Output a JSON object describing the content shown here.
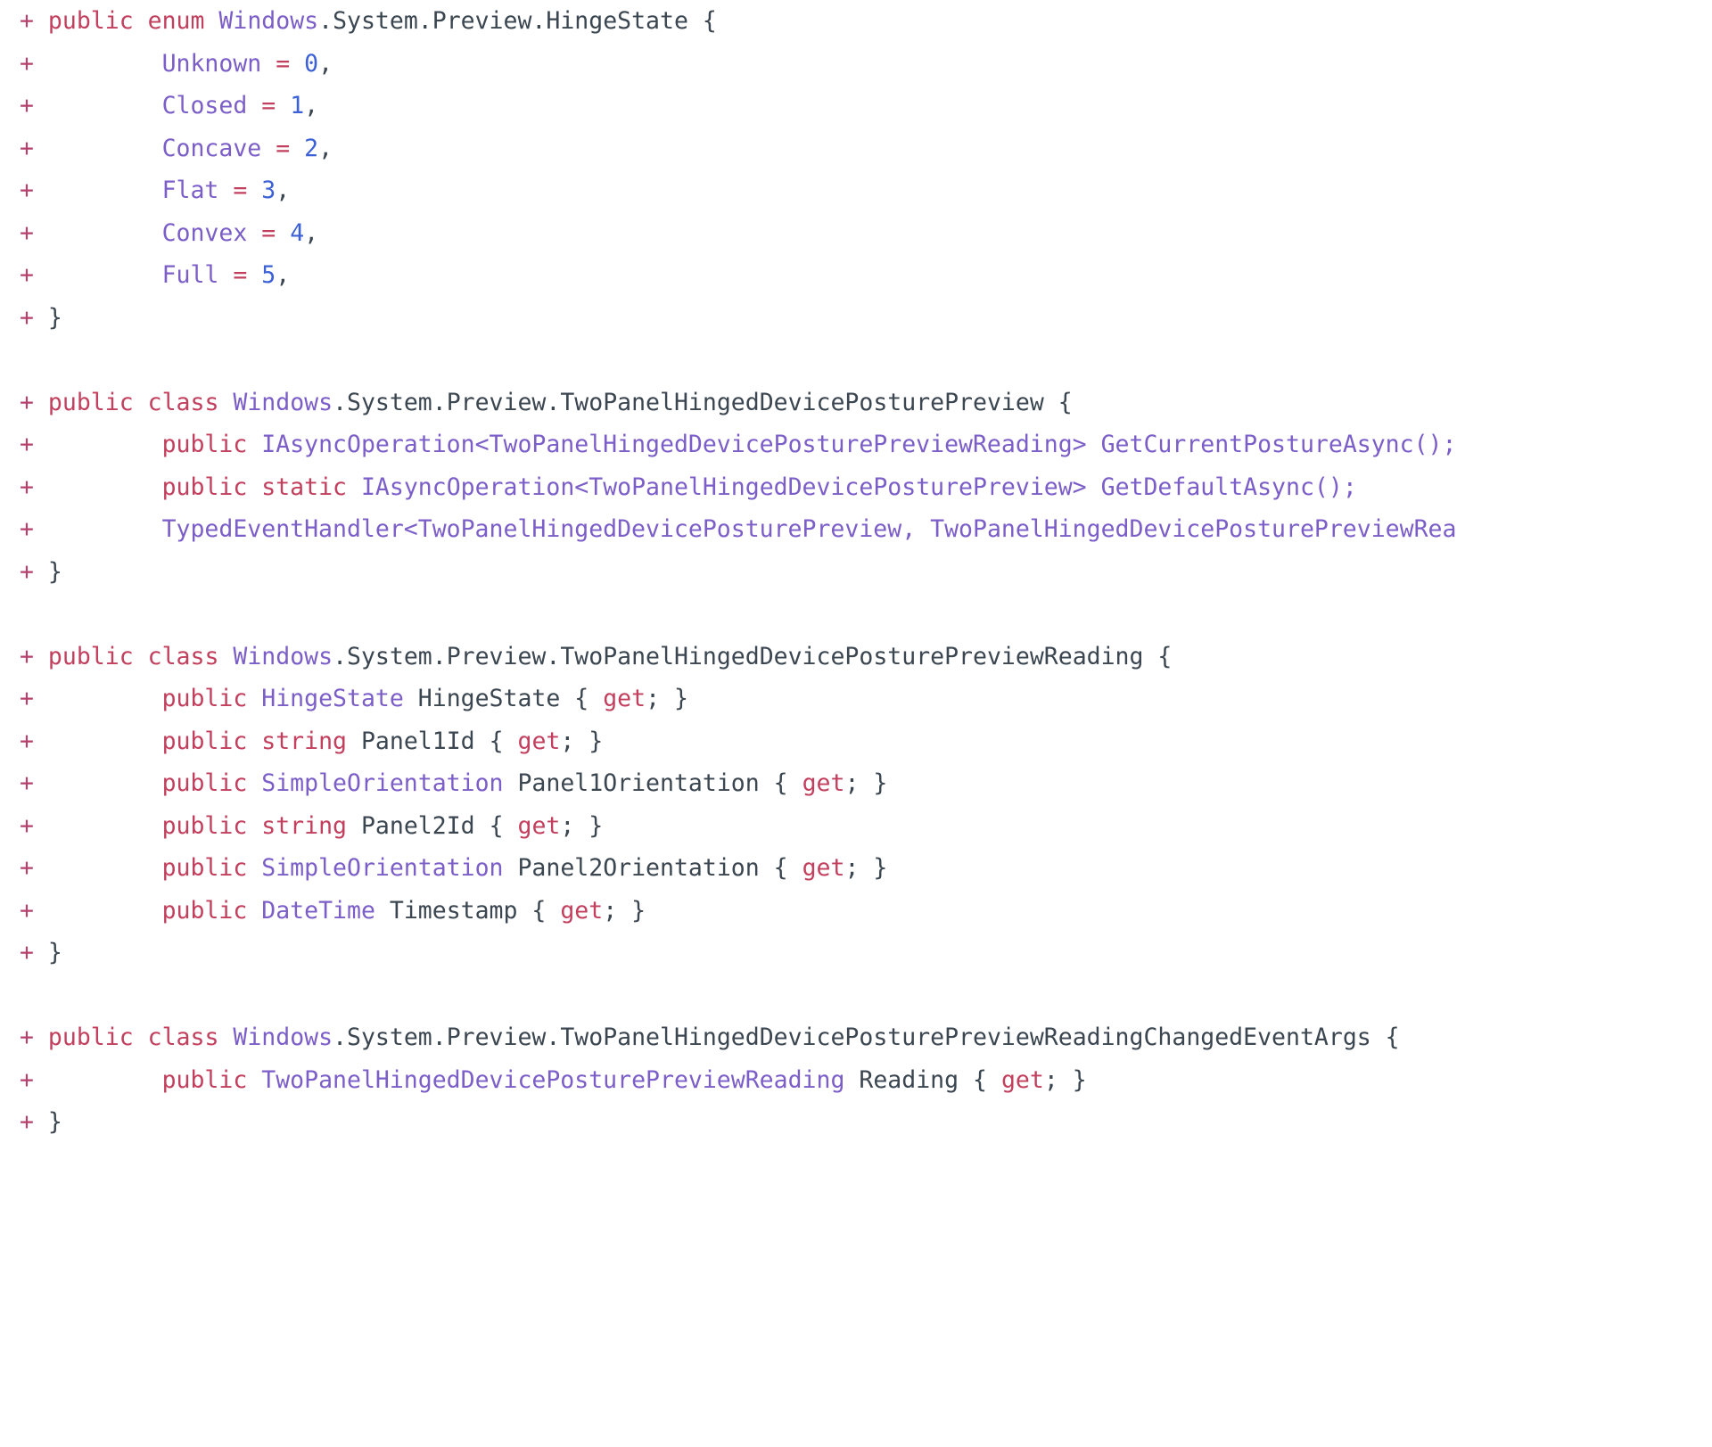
{
  "view": {
    "kind": "code-diff",
    "language": "csharp",
    "background": "#ffffff",
    "colors": {
      "diff_marker": "#b5416c",
      "keyword": "#c2405e",
      "type": "#7b5ec7",
      "identifier": "#3b4650",
      "number": "#3c61d6",
      "operator": "#c2405e",
      "punctuation": "#3b4650"
    }
  },
  "lines": [
    {
      "id": "l1",
      "marker": "+",
      "tokens": [
        {
          "t": "public",
          "c": "kw"
        },
        {
          "t": " ",
          "c": "plain"
        },
        {
          "t": "enum",
          "c": "kw"
        },
        {
          "t": " ",
          "c": "plain"
        },
        {
          "t": "Windows",
          "c": "type"
        },
        {
          "t": ".System.Preview.HingeState {",
          "c": "ident"
        }
      ]
    },
    {
      "id": "l2",
      "marker": "+",
      "indent": 8,
      "tokens": [
        {
          "t": "Unknown",
          "c": "type"
        },
        {
          "t": " ",
          "c": "plain"
        },
        {
          "t": "=",
          "c": "op"
        },
        {
          "t": " ",
          "c": "plain"
        },
        {
          "t": "0",
          "c": "num"
        },
        {
          "t": ",",
          "c": "punct"
        }
      ]
    },
    {
      "id": "l3",
      "marker": "+",
      "indent": 8,
      "tokens": [
        {
          "t": "Closed",
          "c": "type"
        },
        {
          "t": " ",
          "c": "plain"
        },
        {
          "t": "=",
          "c": "op"
        },
        {
          "t": " ",
          "c": "plain"
        },
        {
          "t": "1",
          "c": "num"
        },
        {
          "t": ",",
          "c": "punct"
        }
      ]
    },
    {
      "id": "l4",
      "marker": "+",
      "indent": 8,
      "tokens": [
        {
          "t": "Concave",
          "c": "type"
        },
        {
          "t": " ",
          "c": "plain"
        },
        {
          "t": "=",
          "c": "op"
        },
        {
          "t": " ",
          "c": "plain"
        },
        {
          "t": "2",
          "c": "num"
        },
        {
          "t": ",",
          "c": "punct"
        }
      ]
    },
    {
      "id": "l5",
      "marker": "+",
      "indent": 8,
      "tokens": [
        {
          "t": "Flat",
          "c": "type"
        },
        {
          "t": " ",
          "c": "plain"
        },
        {
          "t": "=",
          "c": "op"
        },
        {
          "t": " ",
          "c": "plain"
        },
        {
          "t": "3",
          "c": "num"
        },
        {
          "t": ",",
          "c": "punct"
        }
      ]
    },
    {
      "id": "l6",
      "marker": "+",
      "indent": 8,
      "tokens": [
        {
          "t": "Convex",
          "c": "type"
        },
        {
          "t": " ",
          "c": "plain"
        },
        {
          "t": "=",
          "c": "op"
        },
        {
          "t": " ",
          "c": "plain"
        },
        {
          "t": "4",
          "c": "num"
        },
        {
          "t": ",",
          "c": "punct"
        }
      ]
    },
    {
      "id": "l7",
      "marker": "+",
      "indent": 8,
      "tokens": [
        {
          "t": "Full",
          "c": "type"
        },
        {
          "t": " ",
          "c": "plain"
        },
        {
          "t": "=",
          "c": "op"
        },
        {
          "t": " ",
          "c": "plain"
        },
        {
          "t": "5",
          "c": "num"
        },
        {
          "t": ",",
          "c": "punct"
        }
      ]
    },
    {
      "id": "l8",
      "marker": "+",
      "tokens": [
        {
          "t": "}",
          "c": "punct"
        }
      ]
    },
    {
      "id": "l9",
      "blank": true
    },
    {
      "id": "l10",
      "marker": "+",
      "tokens": [
        {
          "t": "public",
          "c": "kw"
        },
        {
          "t": " ",
          "c": "plain"
        },
        {
          "t": "class",
          "c": "kw"
        },
        {
          "t": " ",
          "c": "plain"
        },
        {
          "t": "Windows",
          "c": "type"
        },
        {
          "t": ".System.Preview.TwoPanelHingedDevicePosturePreview {",
          "c": "ident"
        }
      ]
    },
    {
      "id": "l11",
      "marker": "+",
      "indent": 8,
      "tokens": [
        {
          "t": "public",
          "c": "kw"
        },
        {
          "t": " ",
          "c": "plain"
        },
        {
          "t": "IAsyncOperation<TwoPanelHingedDevicePosturePreviewReading>",
          "c": "type"
        },
        {
          "t": " ",
          "c": "plain"
        },
        {
          "t": "GetCurrentPostureAsync();",
          "c": "type"
        }
      ]
    },
    {
      "id": "l12",
      "marker": "+",
      "indent": 8,
      "tokens": [
        {
          "t": "public",
          "c": "kw"
        },
        {
          "t": " ",
          "c": "plain"
        },
        {
          "t": "static",
          "c": "kw"
        },
        {
          "t": " ",
          "c": "plain"
        },
        {
          "t": "IAsyncOperation<TwoPanelHingedDevicePosturePreview>",
          "c": "type"
        },
        {
          "t": " ",
          "c": "plain"
        },
        {
          "t": "GetDefaultAsync();",
          "c": "type"
        }
      ]
    },
    {
      "id": "l13",
      "marker": "+",
      "indent": 8,
      "tokens": [
        {
          "t": "TypedEventHandler<TwoPanelHingedDevicePosturePreview,",
          "c": "type"
        },
        {
          "t": " ",
          "c": "plain"
        },
        {
          "t": "TwoPanelHingedDevicePosturePreviewRea",
          "c": "type"
        }
      ]
    },
    {
      "id": "l14",
      "marker": "+",
      "tokens": [
        {
          "t": "}",
          "c": "punct"
        }
      ]
    },
    {
      "id": "l15",
      "blank": true
    },
    {
      "id": "l16",
      "marker": "+",
      "tokens": [
        {
          "t": "public",
          "c": "kw"
        },
        {
          "t": " ",
          "c": "plain"
        },
        {
          "t": "class",
          "c": "kw"
        },
        {
          "t": " ",
          "c": "plain"
        },
        {
          "t": "Windows",
          "c": "type"
        },
        {
          "t": ".System.Preview.TwoPanelHingedDevicePosturePreviewReading {",
          "c": "ident"
        }
      ]
    },
    {
      "id": "l17",
      "marker": "+",
      "indent": 8,
      "tokens": [
        {
          "t": "public",
          "c": "kw"
        },
        {
          "t": " ",
          "c": "plain"
        },
        {
          "t": "HingeState",
          "c": "type"
        },
        {
          "t": " ",
          "c": "plain"
        },
        {
          "t": "HingeState",
          "c": "ident"
        },
        {
          "t": " { ",
          "c": "punct"
        },
        {
          "t": "get",
          "c": "kw"
        },
        {
          "t": "; }",
          "c": "punct"
        }
      ]
    },
    {
      "id": "l18",
      "marker": "+",
      "indent": 8,
      "tokens": [
        {
          "t": "public",
          "c": "kw"
        },
        {
          "t": " ",
          "c": "plain"
        },
        {
          "t": "string",
          "c": "kw"
        },
        {
          "t": " ",
          "c": "plain"
        },
        {
          "t": "Panel1Id",
          "c": "ident"
        },
        {
          "t": " { ",
          "c": "punct"
        },
        {
          "t": "get",
          "c": "kw"
        },
        {
          "t": "; }",
          "c": "punct"
        }
      ]
    },
    {
      "id": "l19",
      "marker": "+",
      "indent": 8,
      "tokens": [
        {
          "t": "public",
          "c": "kw"
        },
        {
          "t": " ",
          "c": "plain"
        },
        {
          "t": "SimpleOrientation",
          "c": "type"
        },
        {
          "t": " ",
          "c": "plain"
        },
        {
          "t": "Panel1Orientation",
          "c": "ident"
        },
        {
          "t": " { ",
          "c": "punct"
        },
        {
          "t": "get",
          "c": "kw"
        },
        {
          "t": "; }",
          "c": "punct"
        }
      ]
    },
    {
      "id": "l20",
      "marker": "+",
      "indent": 8,
      "tokens": [
        {
          "t": "public",
          "c": "kw"
        },
        {
          "t": " ",
          "c": "plain"
        },
        {
          "t": "string",
          "c": "kw"
        },
        {
          "t": " ",
          "c": "plain"
        },
        {
          "t": "Panel2Id",
          "c": "ident"
        },
        {
          "t": " { ",
          "c": "punct"
        },
        {
          "t": "get",
          "c": "kw"
        },
        {
          "t": "; }",
          "c": "punct"
        }
      ]
    },
    {
      "id": "l21",
      "marker": "+",
      "indent": 8,
      "tokens": [
        {
          "t": "public",
          "c": "kw"
        },
        {
          "t": " ",
          "c": "plain"
        },
        {
          "t": "SimpleOrientation",
          "c": "type"
        },
        {
          "t": " ",
          "c": "plain"
        },
        {
          "t": "Panel2Orientation",
          "c": "ident"
        },
        {
          "t": " { ",
          "c": "punct"
        },
        {
          "t": "get",
          "c": "kw"
        },
        {
          "t": "; }",
          "c": "punct"
        }
      ]
    },
    {
      "id": "l22",
      "marker": "+",
      "indent": 8,
      "tokens": [
        {
          "t": "public",
          "c": "kw"
        },
        {
          "t": " ",
          "c": "plain"
        },
        {
          "t": "DateTime",
          "c": "type"
        },
        {
          "t": " ",
          "c": "plain"
        },
        {
          "t": "Timestamp",
          "c": "ident"
        },
        {
          "t": " { ",
          "c": "punct"
        },
        {
          "t": "get",
          "c": "kw"
        },
        {
          "t": "; }",
          "c": "punct"
        }
      ]
    },
    {
      "id": "l23",
      "marker": "+",
      "tokens": [
        {
          "t": "}",
          "c": "punct"
        }
      ]
    },
    {
      "id": "l24",
      "blank": true
    },
    {
      "id": "l25",
      "marker": "+",
      "tokens": [
        {
          "t": "public",
          "c": "kw"
        },
        {
          "t": " ",
          "c": "plain"
        },
        {
          "t": "class",
          "c": "kw"
        },
        {
          "t": " ",
          "c": "plain"
        },
        {
          "t": "Windows",
          "c": "type"
        },
        {
          "t": ".System.Preview.TwoPanelHingedDevicePosturePreviewReadingChangedEventArgs {",
          "c": "ident"
        }
      ]
    },
    {
      "id": "l26",
      "marker": "+",
      "indent": 8,
      "tokens": [
        {
          "t": "public",
          "c": "kw"
        },
        {
          "t": " ",
          "c": "plain"
        },
        {
          "t": "TwoPanelHingedDevicePosturePreviewReading",
          "c": "type"
        },
        {
          "t": " ",
          "c": "plain"
        },
        {
          "t": "Reading",
          "c": "ident"
        },
        {
          "t": " { ",
          "c": "punct"
        },
        {
          "t": "get",
          "c": "kw"
        },
        {
          "t": "; }",
          "c": "punct"
        }
      ]
    },
    {
      "id": "l27",
      "marker": "+",
      "tokens": [
        {
          "t": "}",
          "c": "punct"
        }
      ]
    }
  ]
}
